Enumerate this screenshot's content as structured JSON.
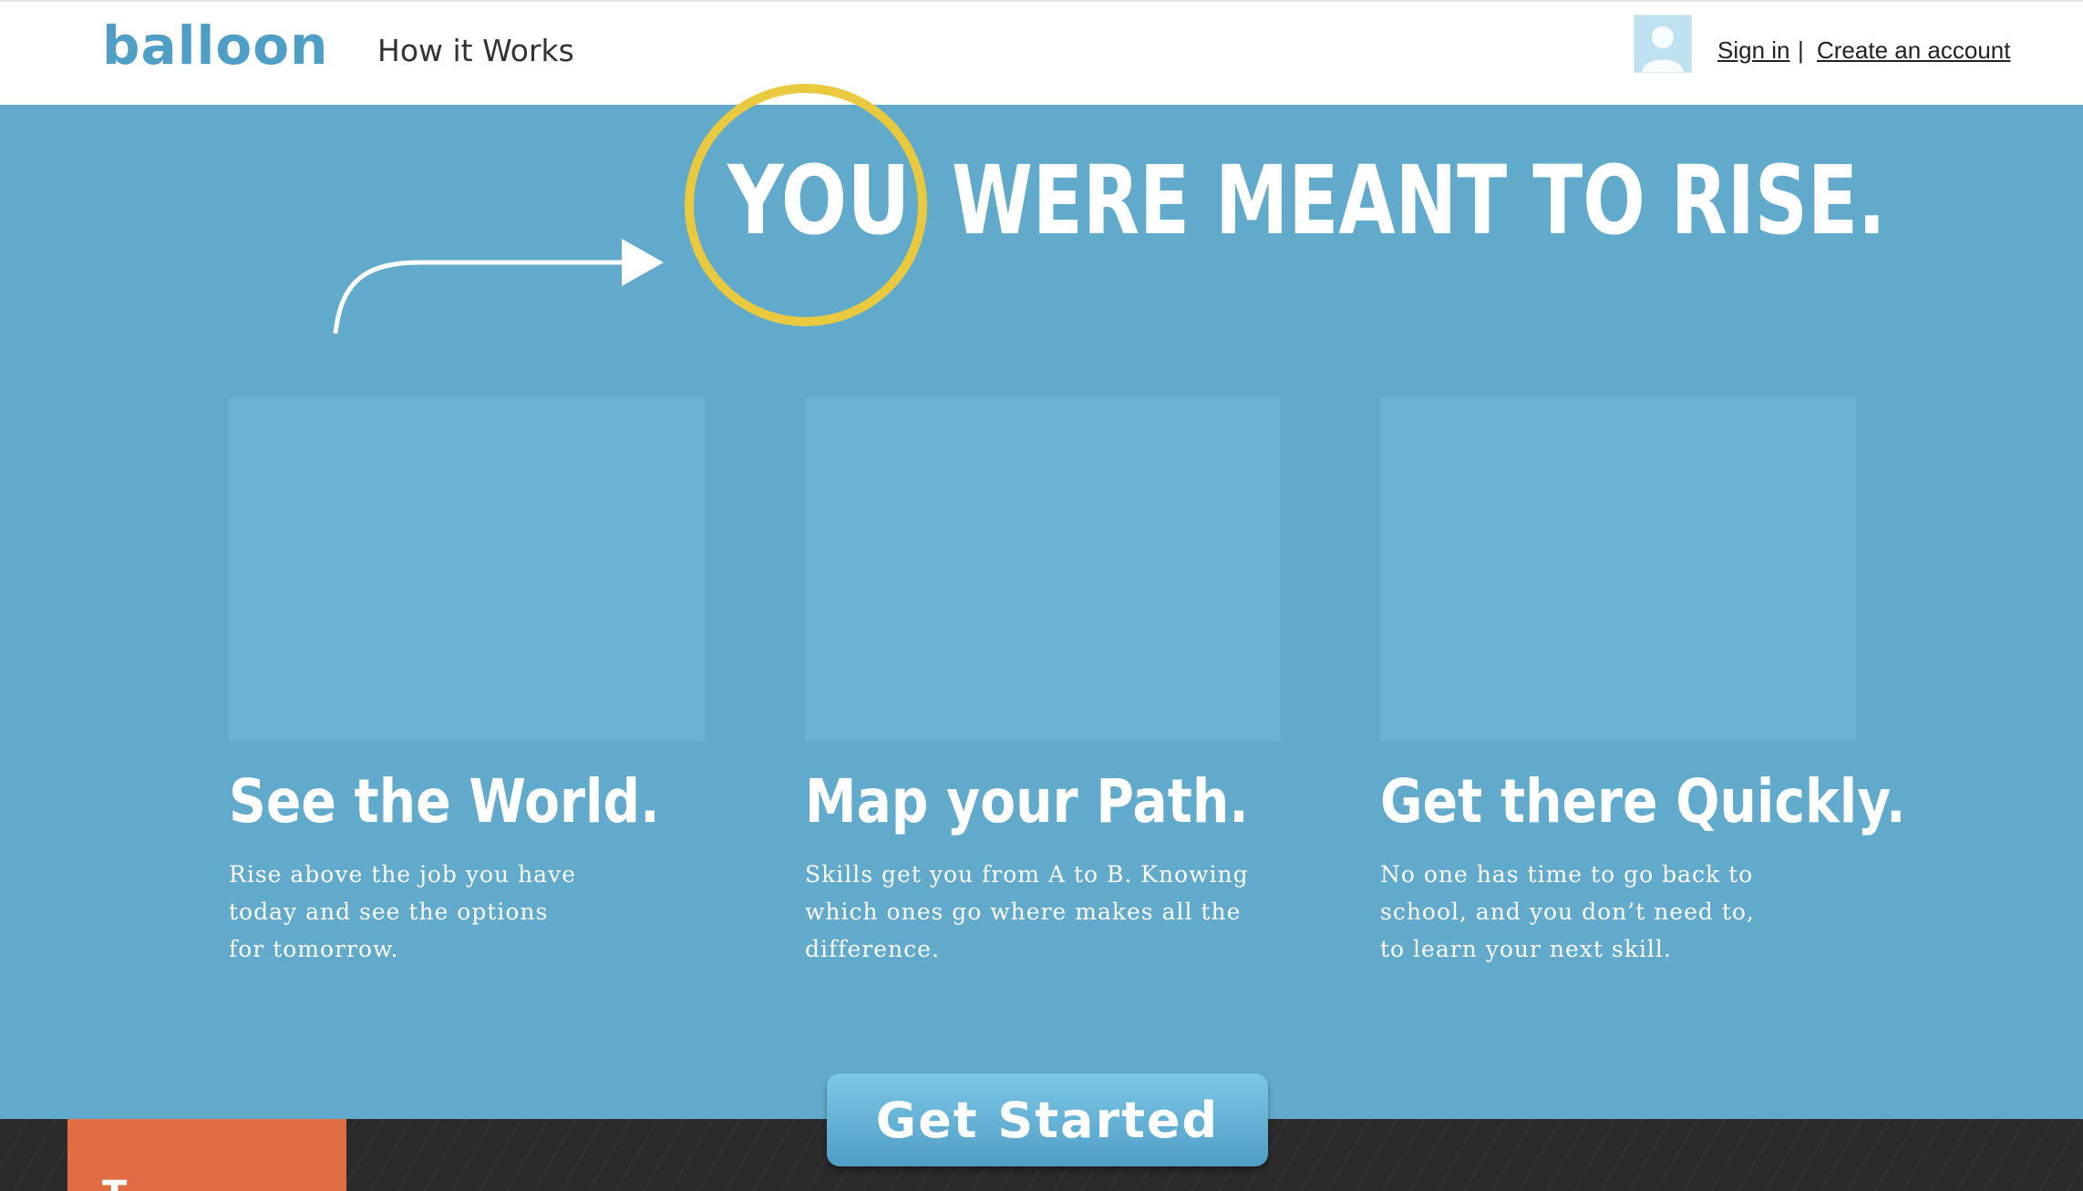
{
  "header": {
    "logo": "balloon",
    "nav": {
      "how_it_works": "How it Works"
    },
    "auth": {
      "sign_in": "Sign in",
      "separator": "|",
      "create_account": "Create an account"
    }
  },
  "hero": {
    "highlight_word": "YOU",
    "rest": "WERE MEANT TO RISE."
  },
  "features": [
    {
      "title": "See the World.",
      "description": "Rise above the job you have\ntoday and see the options\nfor tomorrow."
    },
    {
      "title": "Map your Path.",
      "description": "Skills get you from A to B. Knowing\nwhich ones go where makes all the\ndifference."
    },
    {
      "title": "Get there Quickly.",
      "description": "No one has time to go back to\nschool, and you don’t need to,\nto learn your next skill."
    }
  ],
  "cta": {
    "label": "Get Started"
  },
  "footer": {
    "tab_label_partial": "T"
  },
  "colors": {
    "background": "#62aacc",
    "brand": "#4f9ec6",
    "highlight_ring": "#e9c93d",
    "card": "#69b2d3",
    "footer_dark": "#2a2a2a",
    "accent_orange": "#e06d43"
  }
}
